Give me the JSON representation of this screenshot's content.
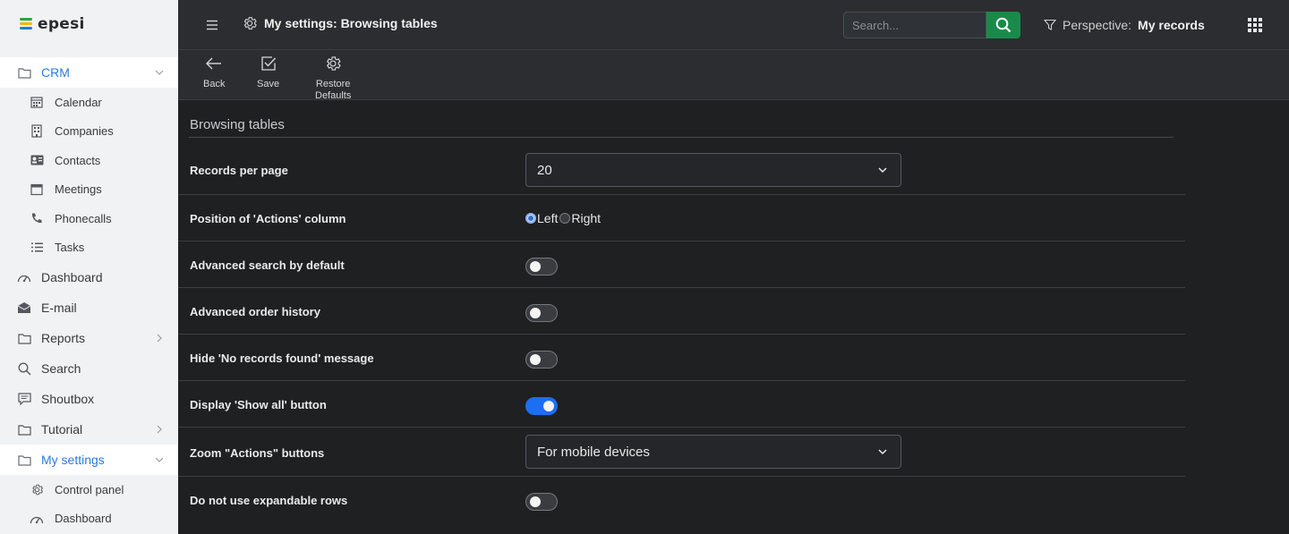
{
  "app": {
    "logo_text": "epesi"
  },
  "sidebar": {
    "items": [
      {
        "label": "CRM",
        "active": true,
        "expandable": true,
        "icon": "folder-icon",
        "children": [
          {
            "label": "Calendar",
            "icon": "calendar-icon"
          },
          {
            "label": "Companies",
            "icon": "building-icon"
          },
          {
            "label": "Contacts",
            "icon": "contact-card-icon"
          },
          {
            "label": "Meetings",
            "icon": "meeting-icon"
          },
          {
            "label": "Phonecalls",
            "icon": "phone-icon"
          },
          {
            "label": "Tasks",
            "icon": "tasks-list-icon"
          }
        ]
      },
      {
        "label": "Dashboard",
        "icon": "dashboard-gauge-icon"
      },
      {
        "label": "E-mail",
        "icon": "envelope-icon"
      },
      {
        "label": "Reports",
        "icon": "folder-icon",
        "expandable": true
      },
      {
        "label": "Search",
        "icon": "search-icon"
      },
      {
        "label": "Shoutbox",
        "icon": "chat-icon"
      },
      {
        "label": "Tutorial",
        "icon": "folder-icon",
        "expandable": true
      },
      {
        "label": "My settings",
        "active": true,
        "expandable": true,
        "icon": "folder-icon",
        "children": [
          {
            "label": "Control panel",
            "icon": "gear-icon"
          },
          {
            "label": "Dashboard",
            "icon": "dashboard-gauge-icon"
          }
        ]
      }
    ]
  },
  "header": {
    "title": "My settings: Browsing tables",
    "search_placeholder": "Search...",
    "perspective_label": "Perspective:",
    "perspective_value": "My records"
  },
  "toolbar": {
    "back_label": "Back",
    "save_label": "Save",
    "restore_label_1": "Restore",
    "restore_label_2": "Defaults"
  },
  "settings": {
    "section_title": "Browsing tables",
    "records_per_page": {
      "label": "Records per page",
      "value": "20"
    },
    "actions_position": {
      "label": "Position of 'Actions' column",
      "options": [
        "Left",
        "Right"
      ],
      "selected": "Left"
    },
    "advanced_search": {
      "label": "Advanced search by default",
      "enabled": false
    },
    "advanced_order": {
      "label": "Advanced order history",
      "enabled": false
    },
    "hide_no_records": {
      "label": "Hide 'No records found' message",
      "enabled": false
    },
    "display_show_all": {
      "label": "Display 'Show all' button",
      "enabled": true
    },
    "zoom_actions": {
      "label": "Zoom \"Actions\" buttons",
      "value": "For mobile devices"
    },
    "no_expandable_rows": {
      "label": "Do not use expandable rows",
      "enabled": false
    }
  },
  "colors": {
    "accent": "#2a7be4",
    "search_button": "#1a8a4a",
    "toggle_on": "#1c6ef2",
    "logo_green": "#27a844",
    "logo_yellow": "#f5b800",
    "logo_blue": "#1f7bd6"
  }
}
